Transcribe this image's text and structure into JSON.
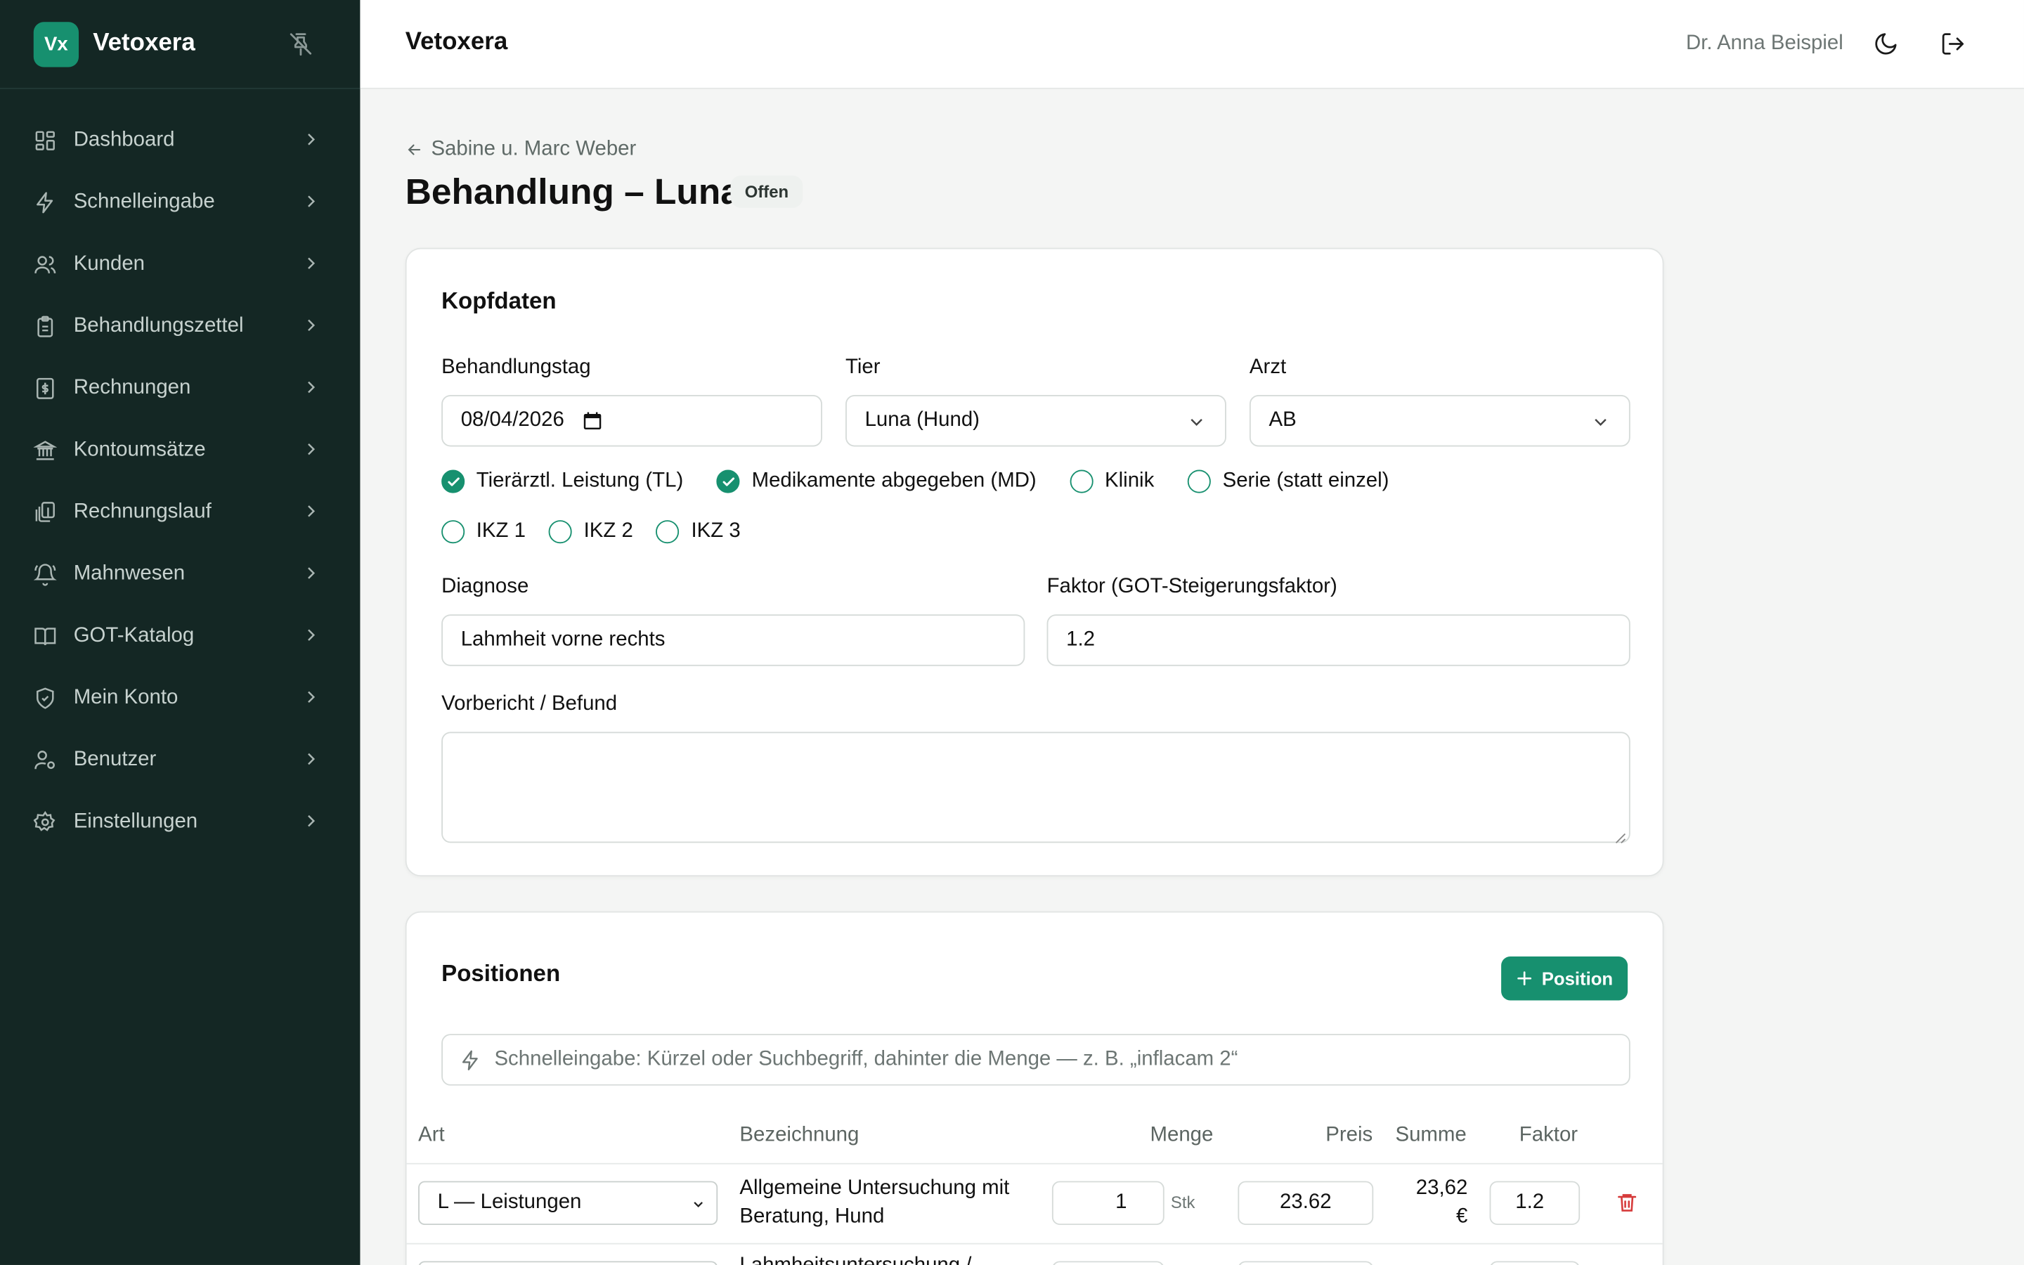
{
  "brand": {
    "logo": "Vx",
    "name": "Vetoxera"
  },
  "sidebar": {
    "items": [
      {
        "label": "Dashboard",
        "icon": "dashboard-icon"
      },
      {
        "label": "Schnelleingabe",
        "icon": "zap-icon"
      },
      {
        "label": "Kunden",
        "icon": "users-icon"
      },
      {
        "label": "Behandlungszettel",
        "icon": "clipboard-icon"
      },
      {
        "label": "Rechnungen",
        "icon": "invoice-icon"
      },
      {
        "label": "Kontoumsätze",
        "icon": "bank-icon"
      },
      {
        "label": "Rechnungslauf",
        "icon": "files-icon"
      },
      {
        "label": "Mahnwesen",
        "icon": "bell-icon"
      },
      {
        "label": "GOT-Katalog",
        "icon": "book-icon"
      },
      {
        "label": "Mein Konto",
        "icon": "shield-icon"
      },
      {
        "label": "Benutzer",
        "icon": "user-cog-icon"
      },
      {
        "label": "Einstellungen",
        "icon": "gear-icon"
      }
    ]
  },
  "header": {
    "title": "Vetoxera",
    "user": "Dr. Anna Beispiel"
  },
  "page": {
    "back_label": "Sabine u. Marc Weber",
    "title": "Behandlung – Luna",
    "status": "Offen"
  },
  "kopfdaten": {
    "heading": "Kopfdaten",
    "behandlungstag_label": "Behandlungstag",
    "behandlungstag_value": "08/04/2026",
    "tier_label": "Tier",
    "tier_value": "Luna (Hund)",
    "arzt_label": "Arzt",
    "arzt_value": "AB",
    "checks": [
      {
        "label": "Tierärztl. Leistung (TL)",
        "checked": true
      },
      {
        "label": "Medikamente abgegeben (MD)",
        "checked": true
      },
      {
        "label": "Klinik",
        "checked": false
      },
      {
        "label": "Serie (statt einzel)",
        "checked": false
      }
    ],
    "ikz": [
      {
        "label": "IKZ 1",
        "checked": false
      },
      {
        "label": "IKZ 2",
        "checked": false
      },
      {
        "label": "IKZ 3",
        "checked": false
      }
    ],
    "diagnose_label": "Diagnose",
    "diagnose_value": "Lahmheit vorne rechts",
    "faktor_label": "Faktor (GOT-Steigerungsfaktor)",
    "faktor_value": "1.2",
    "vorbericht_label": "Vorbericht / Befund",
    "vorbericht_value": ""
  },
  "positionen": {
    "heading": "Positionen",
    "add_label": "Position",
    "quick_placeholder": "Schnelleingabe: Kürzel oder Suchbegriff, dahinter die Menge — z. B. „inflacam 2“",
    "columns": {
      "art": "Art",
      "bezeichnung": "Bezeichnung",
      "menge": "Menge",
      "preis": "Preis",
      "summe": "Summe",
      "faktor": "Faktor"
    },
    "rows": [
      {
        "art": "L — Leistungen",
        "bezeichnung_1": "Allgemeine Untersuchung mit",
        "bezeichnung_2": "Beratung, Hund",
        "menge": "1",
        "einheit": "Stk",
        "preis": "23.62",
        "summe_1": "23,62",
        "summe_2": "€",
        "faktor": "1.2"
      },
      {
        "bezeichnung_1": "Lahmheitsuntersuchung /"
      }
    ]
  },
  "colors": {
    "accent": "#17906f",
    "sidebar_bg": "#142724",
    "danger": "#d63b3b"
  }
}
